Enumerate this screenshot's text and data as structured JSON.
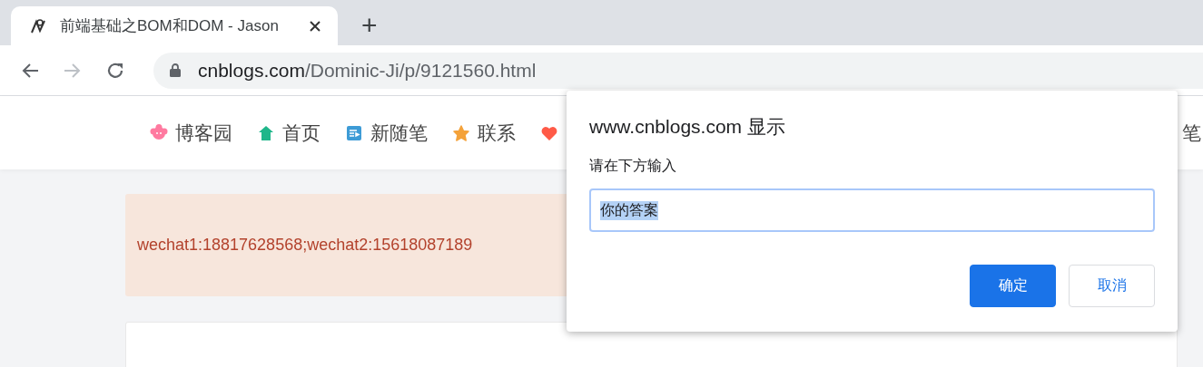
{
  "browser": {
    "tab": {
      "title": "前端基础之BOM和DOM - Jason",
      "selected": true
    },
    "new_tab": "+",
    "address": {
      "domain": "cnblogs.com",
      "path": "/Dominic-Ji/p/9121560.html"
    }
  },
  "nav": {
    "items": [
      {
        "kind": "flower",
        "label": "博客园"
      },
      {
        "kind": "home",
        "label": "首页"
      },
      {
        "kind": "post",
        "label": "新随笔"
      },
      {
        "kind": "star",
        "label": "联系"
      },
      {
        "kind": "heart"
      }
    ],
    "trailing": "笔"
  },
  "notice": {
    "text": "wechat1:18817628568;wechat2:15618087189"
  },
  "dialog": {
    "title": "www.cnblogs.com 显示",
    "message": "请在下方输入",
    "input": {
      "value": "你的答案",
      "value_selected": true
    },
    "buttons": [
      {
        "label": "确定",
        "primary": true
      },
      {
        "label": "取消",
        "primary": false
      }
    ]
  }
}
